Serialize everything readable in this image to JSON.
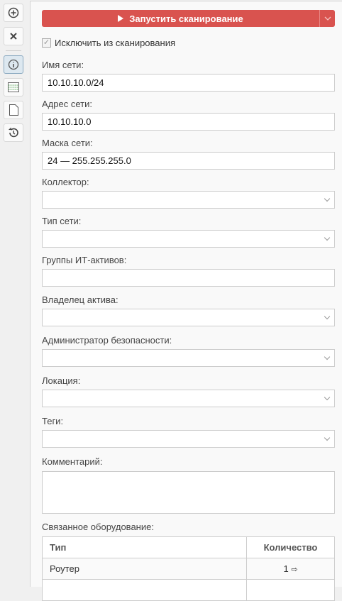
{
  "sidebar": {
    "items": [
      {
        "name": "add",
        "icon": "plus-circle-icon"
      },
      {
        "name": "close",
        "icon": "close-icon"
      },
      {
        "name": "info",
        "icon": "info-icon",
        "active": true
      },
      {
        "name": "table",
        "icon": "table-icon"
      },
      {
        "name": "document",
        "icon": "document-icon"
      },
      {
        "name": "history",
        "icon": "history-icon"
      }
    ]
  },
  "run_button": {
    "label": "Запустить сканирование"
  },
  "exclude": {
    "label": "Исключить из сканирования",
    "checked": true
  },
  "fields": {
    "name": {
      "label": "Имя сети:",
      "value": "10.10.10.0/24"
    },
    "address": {
      "label": "Адрес сети:",
      "value": "10.10.10.0"
    },
    "mask": {
      "label": "Маска сети:",
      "value": "24 — 255.255.255.0"
    },
    "collector": {
      "label": "Коллектор:",
      "value": ""
    },
    "net_type": {
      "label": "Тип сети:",
      "value": ""
    },
    "groups": {
      "label": "Группы ИТ-активов:",
      "value": ""
    },
    "owner": {
      "label": "Владелец актива:",
      "value": ""
    },
    "admin": {
      "label": "Администратор безопасности:",
      "value": ""
    },
    "location": {
      "label": "Локация:",
      "value": ""
    },
    "tags": {
      "label": "Теги:",
      "value": ""
    },
    "comment": {
      "label": "Комментарий:",
      "value": ""
    }
  },
  "equipment": {
    "label": "Связанное оборудование:",
    "headers": [
      "Тип",
      "Количество"
    ],
    "rows": [
      {
        "type": "Роутер",
        "count": "1"
      }
    ]
  },
  "colors": {
    "accent": "#d9534f"
  }
}
